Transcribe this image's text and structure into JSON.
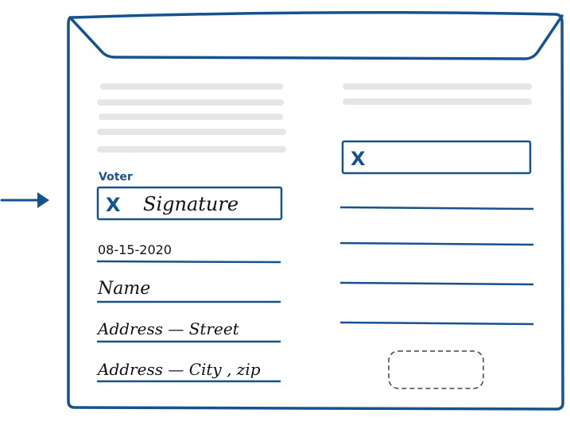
{
  "colors": {
    "ink_blue": "#15528f",
    "placeholder_gray": "#e6e6e6",
    "dashed_gray": "#444444",
    "handwriting": "#111111"
  },
  "arrow": {
    "icon": "right-arrow-icon"
  },
  "envelope": {
    "icon": "envelope-flap"
  },
  "left_column": {
    "voter_label": "Voter",
    "signature_box": {
      "mark": "X",
      "text": "Signature"
    },
    "fields": [
      {
        "name": "date",
        "value": "08-15-2020"
      },
      {
        "name": "name",
        "value": "Name"
      },
      {
        "name": "address-street",
        "value": "Address — Street"
      },
      {
        "name": "address-city-zip",
        "value": "Address — City , zip"
      }
    ],
    "placeholder_line_count": 5
  },
  "right_column": {
    "signature_box": {
      "mark": "X",
      "text": ""
    },
    "blank_line_count": 4,
    "placeholder_line_count": 2,
    "stamp_placeholder": "dashed-box"
  }
}
